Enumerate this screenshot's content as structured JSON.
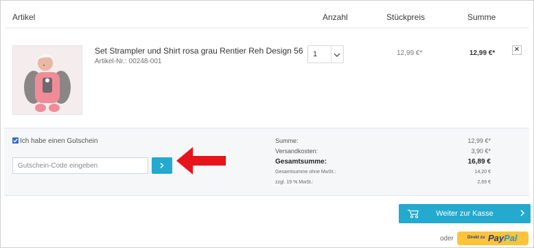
{
  "table_header": {
    "artikel": "Artikel",
    "anzahl": "Anzahl",
    "stueckpreis": "Stückpreis",
    "summe": "Summe"
  },
  "item": {
    "name": "Set Strampler und Shirt rosa grau Rentier Reh Design 56",
    "article_number_label": "Artikel-Nr.:",
    "article_number": "00248-001",
    "quantity": "1",
    "unit_price": "12,99 €*",
    "line_total": "12,99 €*",
    "remove_symbol": "✕"
  },
  "voucher": {
    "checkbox_label": "Ich habe einen Gutschein",
    "checked": true,
    "input_placeholder": "Gutschein-Code eingeben"
  },
  "summary": [
    {
      "label": "Summe:",
      "value": "12,99 €*",
      "style": "normal"
    },
    {
      "label": "Versandkosten:",
      "value": "3,90 €*",
      "style": "normal"
    },
    {
      "label": "Gesamtsumme:",
      "value": "16,89 €",
      "style": "bold"
    },
    {
      "label": "Gesamtsumme ohne MwSt.:",
      "value": "14,20 €",
      "style": "small"
    },
    {
      "label": "zzgl. 19 % MwSt.:",
      "value": "2,69 €",
      "style": "small"
    }
  ],
  "checkout": {
    "button_label": "Weiter zur Kasse",
    "oder": "oder",
    "paypal_small": "Direkt zu",
    "paypal_pay": "Pay",
    "paypal_pal": "Pal"
  },
  "colors": {
    "accent": "#24a9cf",
    "annotation_arrow": "#e8141b",
    "paypal_bg": "#ffc33a"
  }
}
